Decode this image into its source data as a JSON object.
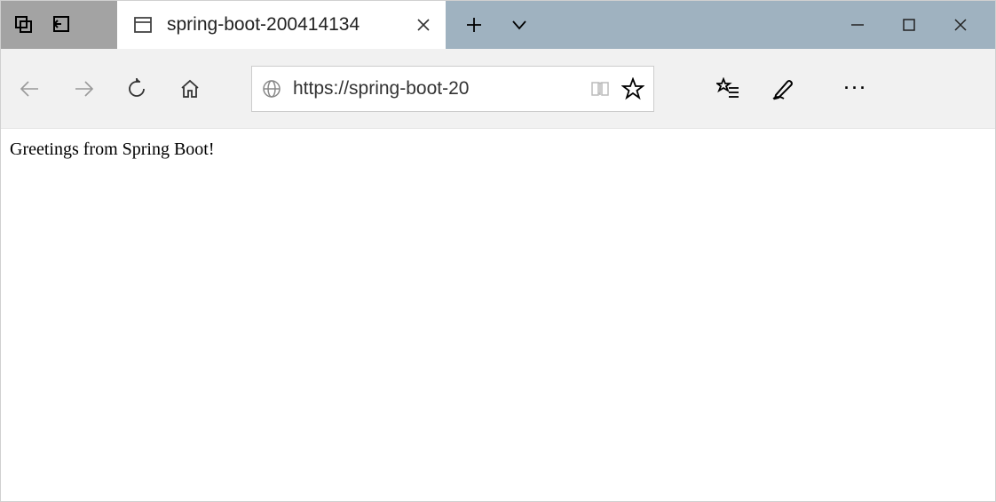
{
  "tab": {
    "title": "spring-boot-200414134"
  },
  "address": {
    "url": "https://spring-boot-20"
  },
  "page": {
    "body_text": "Greetings from Spring Boot!"
  }
}
